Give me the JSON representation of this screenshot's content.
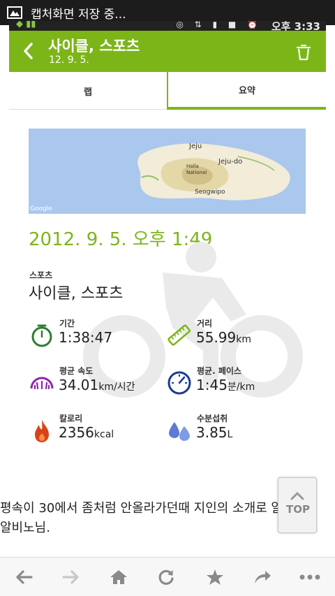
{
  "notification": {
    "text": "캡처화면 저장 중...",
    "icon": "image-icon"
  },
  "status_bar": {
    "time": "오후 3:33"
  },
  "app_bar": {
    "title": "사이클, 스포츠",
    "subtitle": "12. 9. 5.",
    "back_icon": "back-arrow-icon",
    "delete_icon": "trash-icon",
    "color": "#7cb518"
  },
  "tabs": [
    {
      "label": "랩",
      "selected": false
    },
    {
      "label": "요약",
      "selected": true
    }
  ],
  "map": {
    "labels": {
      "jeju_si": "Jeju",
      "jeju_do": "Jeju-do",
      "hallasan": "Halla National",
      "seogwipo": "Seogwipo",
      "google": "Google"
    }
  },
  "datetime": "2012. 9. 5. 오후 1:49",
  "sport": {
    "label": "스포츠",
    "value": "사이클, 스포츠"
  },
  "stats": {
    "duration": {
      "label": "기간",
      "value": "1:38:47",
      "unit": "",
      "icon": "stopwatch-icon",
      "color": "#2e7d32"
    },
    "distance": {
      "label": "거리",
      "value": "55.99",
      "unit": "km",
      "icon": "ruler-icon",
      "color": "#7cb518"
    },
    "avg_speed": {
      "label": "평균 속도",
      "value": "34.01",
      "unit": "km/시간",
      "icon": "speedometer-icon",
      "color": "#8e24aa"
    },
    "avg_pace": {
      "label": "평균. 페이스",
      "value": "1:45",
      "unit": "분/km",
      "icon": "gauge-icon",
      "color": "#1a3a8f"
    },
    "calories": {
      "label": "칼로리",
      "value": "2356",
      "unit": "kcal",
      "icon": "flame-icon",
      "color": "#d84315"
    },
    "hydration": {
      "label": "수분섭취",
      "value": "3.85",
      "unit": "L",
      "icon": "water-drops-icon",
      "color": "#5c7bd6"
    }
  },
  "post_text": "평속이 30에서 좀처럼 안올라가던때 지인의 소개로 알게된 알비노님.",
  "top_button": {
    "label": "TOP",
    "icon": "chevron-up-icon"
  },
  "bottom_bar": {
    "items": [
      "back-arrow-icon",
      "forward-arrow-icon",
      "home-icon",
      "refresh-icon",
      "star-icon",
      "share-icon",
      "more-icon"
    ]
  }
}
